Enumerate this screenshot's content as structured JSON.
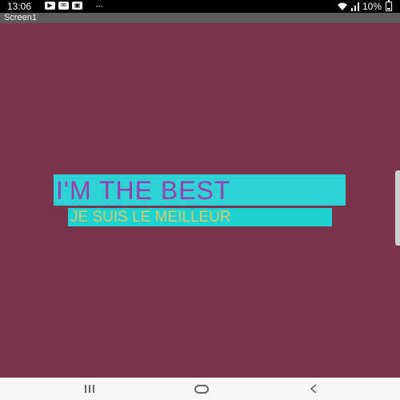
{
  "status_bar": {
    "time": "13:06",
    "battery_percent": "10%",
    "left_icons": [
      "youtube-icon",
      "mail-icon",
      "gallery-icon"
    ],
    "more": "···"
  },
  "app": {
    "screen_title": "Screen1"
  },
  "screen": {
    "background": "#7a334b",
    "title_label": "I'M THE BEST",
    "subtitle_label": "JE SUIS LE MEILLEUR",
    "title_bg": "#2ed1d6",
    "title_color": "#9a3fb0",
    "subtitle_bg": "#1fd2d2",
    "subtitle_color": "#d9c86a"
  },
  "nav_bar": {
    "recent_icon": "recent-apps-icon",
    "home_icon": "home-icon",
    "back_icon": "back-icon"
  }
}
